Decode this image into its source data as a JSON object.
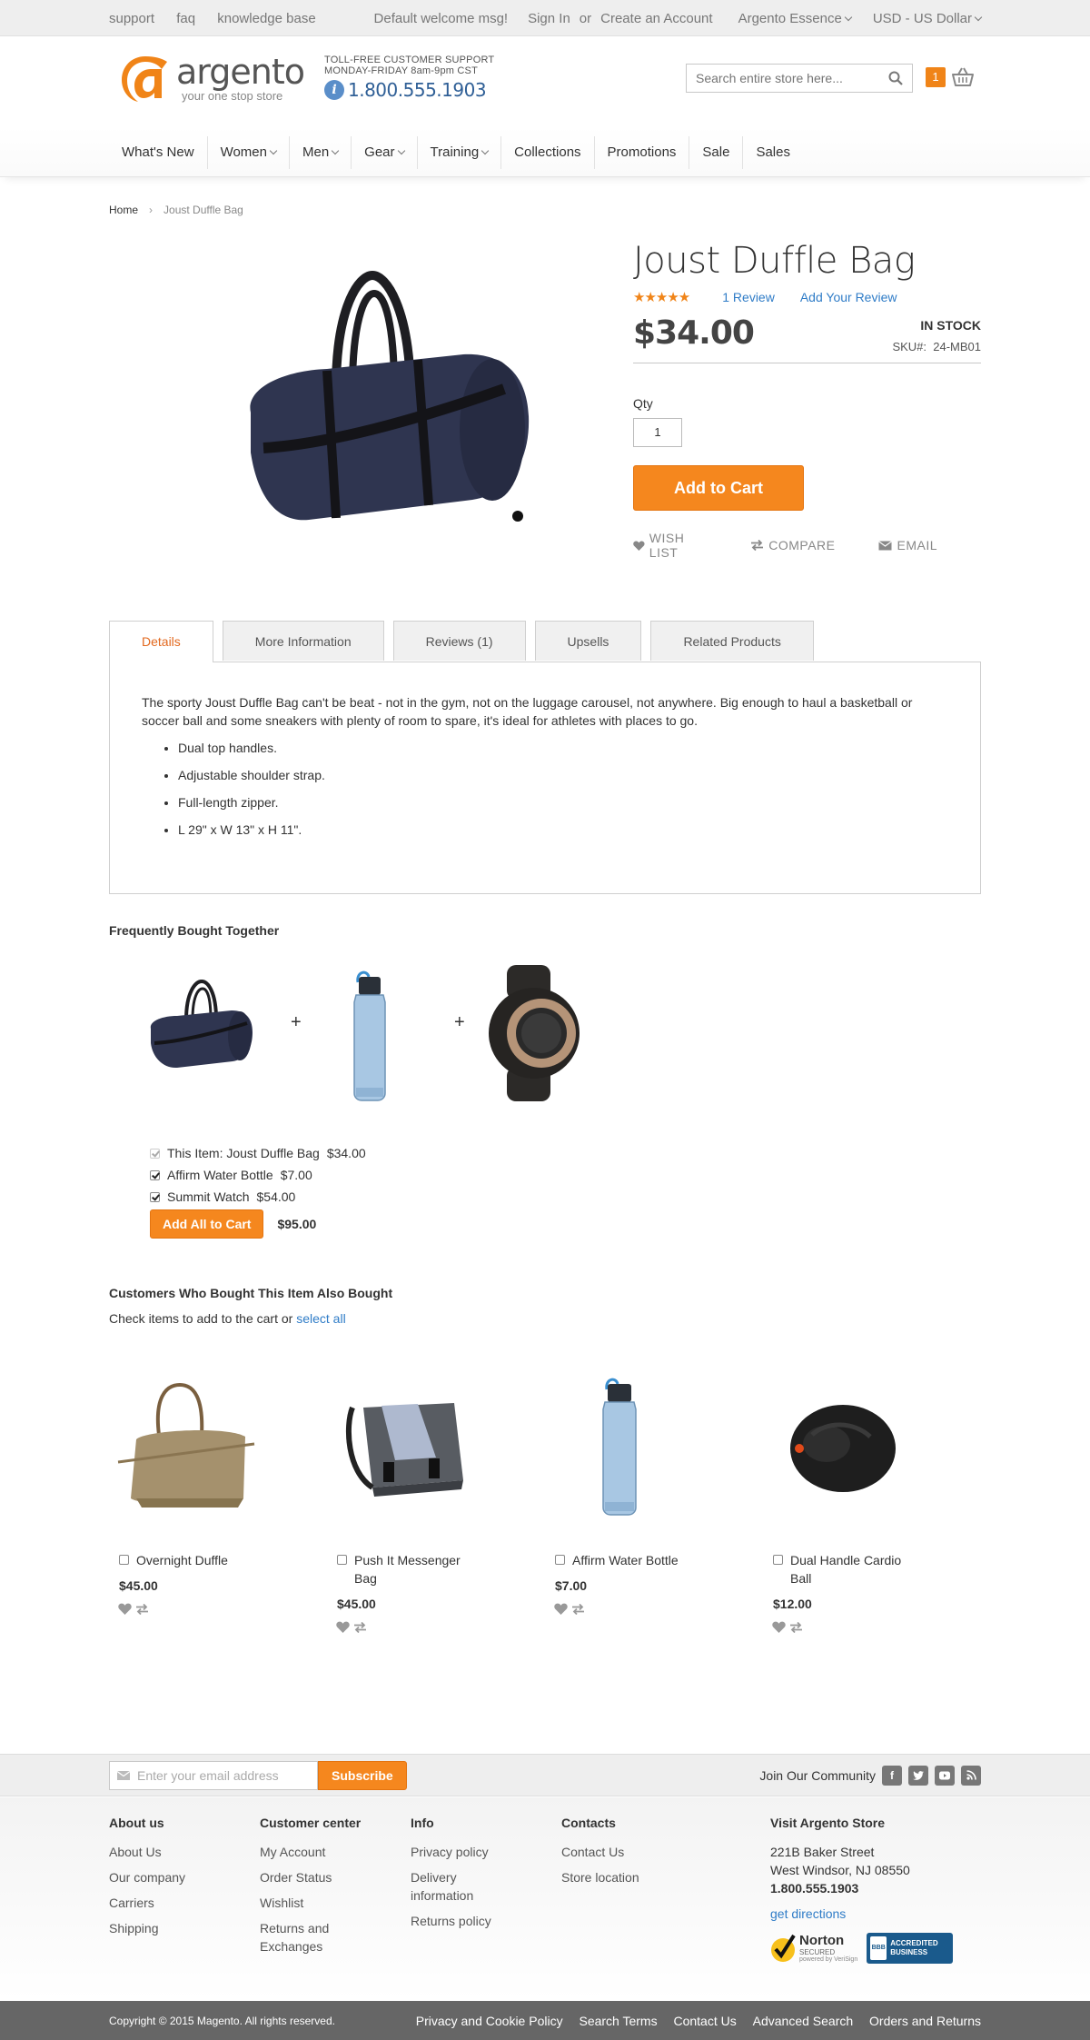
{
  "topbar": {
    "left_links": [
      "support",
      "faq",
      "knowledge base"
    ],
    "welcome": "Default welcome msg!",
    "sign_in": "Sign In",
    "or": "or",
    "create_account": "Create an Account",
    "store_switcher": "Argento Essence",
    "currency": "USD - US Dollar"
  },
  "header": {
    "logo_name": "argento",
    "logo_tagline": "your one stop store",
    "support_line1": "TOLL-FREE CUSTOMER SUPPORT",
    "support_line2": "MONDAY-FRIDAY 8am-9pm CST",
    "support_phone": "1.800.555.1903",
    "search_placeholder": "Search entire store here...",
    "cart_count": "1"
  },
  "nav": {
    "items": [
      "What's New",
      "Women",
      "Men",
      "Gear",
      "Training",
      "Collections",
      "Promotions",
      "Sale",
      "Sales"
    ]
  },
  "breadcrumb": {
    "home": "Home",
    "current": "Joust Duffle Bag"
  },
  "product": {
    "title": "Joust Duffle Bag",
    "stars": "★★★★★",
    "reviews_link": "1 Review",
    "add_review_link": "Add Your Review",
    "price": "$34.00",
    "stock": "IN STOCK",
    "sku_label": "SKU#:",
    "sku": "24-MB01",
    "qty_label": "Qty",
    "qty": "1",
    "add_to_cart": "Add to Cart",
    "wishlist": "WISH LIST",
    "compare": "COMPARE",
    "email": "EMAIL"
  },
  "tabs": {
    "items": [
      "Details",
      "More Information",
      "Reviews (1)",
      "Upsells",
      "Related Products"
    ],
    "description": "The sporty Joust Duffle Bag can't be beat - not in the gym, not on the luggage carousel, not anywhere. Big enough to haul a basketball or soccer ball and some sneakers with plenty of room to spare, it's ideal for athletes with places to go.",
    "bullets": [
      "Dual top handles.",
      "Adjustable shoulder strap.",
      "Full-length zipper.",
      "L 29\" x W 13\" x H 11\"."
    ]
  },
  "fbt": {
    "title": "Frequently Bought Together",
    "plus": "+",
    "rows": [
      {
        "name": "This Item: Joust Duffle Bag",
        "price": "$34.00"
      },
      {
        "name": "Affirm Water Bottle",
        "price": "$7.00"
      },
      {
        "name": "Summit Watch",
        "price": "$54.00"
      }
    ],
    "button": "Add All to Cart",
    "total": "$95.00"
  },
  "also_bought": {
    "title": "Customers Who Bought This Item Also Bought",
    "subtitle": "Check items to add to the cart or",
    "select_all": "select all",
    "items": [
      {
        "name": "Overnight Duffle",
        "price": "$45.00"
      },
      {
        "name": "Push It Messenger Bag",
        "price": "$45.00"
      },
      {
        "name": "Affirm Water Bottle",
        "price": "$7.00"
      },
      {
        "name": "Dual Handle Cardio Ball",
        "price": "$12.00"
      }
    ]
  },
  "newsletter": {
    "placeholder": "Enter your email address",
    "subscribe": "Subscribe",
    "community": "Join Our Community"
  },
  "footer": {
    "columns": [
      {
        "title": "About us",
        "links": [
          "About Us",
          "Our company",
          "Carriers",
          "Shipping"
        ]
      },
      {
        "title": "Customer center",
        "links": [
          "My Account",
          "Order Status",
          "Wishlist",
          "Returns and Exchanges"
        ]
      },
      {
        "title": "Info",
        "links": [
          "Privacy policy",
          "Delivery information",
          "Returns policy"
        ]
      },
      {
        "title": "Contacts",
        "links": [
          "Contact Us",
          "Store location"
        ]
      }
    ],
    "visit_title": "Visit Argento Store",
    "address1": "221B Baker Street",
    "address2": "West Windsor, NJ 08550",
    "phone": "1.800.555.1903",
    "directions": "get directions",
    "norton": "Norton",
    "norton_sub": "SECURED",
    "norton_powered": "powered by VeriSign",
    "bbb": "ACCREDITED BUSINESS",
    "copyright": "Copyright © 2015 Magento. All rights reserved.",
    "bottom_links": [
      "Privacy and Cookie Policy",
      "Search Terms",
      "Contact Us",
      "Advanced Search",
      "Orders and Returns"
    ]
  },
  "colors": {
    "accent": "#f5871e",
    "link": "#2f7cc7",
    "active_tab": "#e2681e",
    "footer_bar": "#666666"
  }
}
